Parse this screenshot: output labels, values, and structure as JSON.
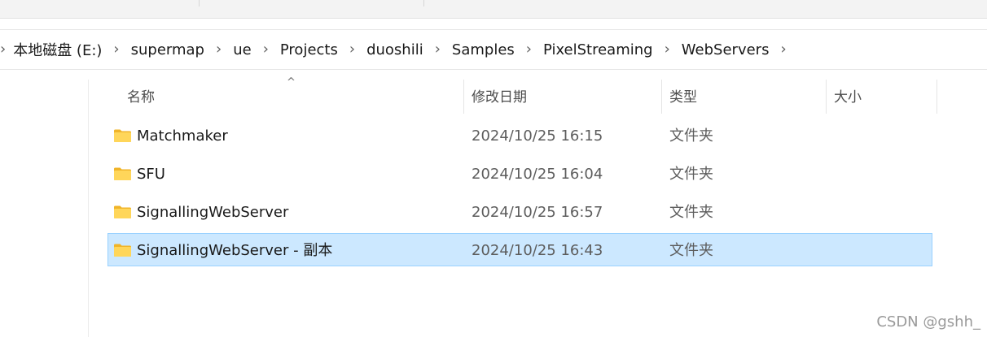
{
  "breadcrumb": [
    "本地磁盘 (E:)",
    "supermap",
    "ue",
    "Projects",
    "duoshili",
    "Samples",
    "PixelStreaming",
    "WebServers"
  ],
  "columns": {
    "name": "名称",
    "date_modified": "修改日期",
    "type": "类型",
    "size": "大小"
  },
  "files": [
    {
      "name": "Matchmaker",
      "date": "2024/10/25 16:15",
      "type": "文件夹",
      "selected": false
    },
    {
      "name": "SFU",
      "date": "2024/10/25 16:04",
      "type": "文件夹",
      "selected": false
    },
    {
      "name": "SignallingWebServer",
      "date": "2024/10/25 16:57",
      "type": "文件夹",
      "selected": false
    },
    {
      "name": "SignallingWebServer - 副本",
      "date": "2024/10/25 16:43",
      "type": "文件夹",
      "selected": true
    }
  ],
  "watermark": "CSDN @gshh_",
  "icons": {
    "folder": "folder-icon",
    "chevron": "chevron-right-icon",
    "sort": "sort-ascending-icon"
  },
  "colors": {
    "selection_bg": "#cce8ff",
    "selection_border": "#99d1ff",
    "folder_yellow": "#f8c93b"
  }
}
